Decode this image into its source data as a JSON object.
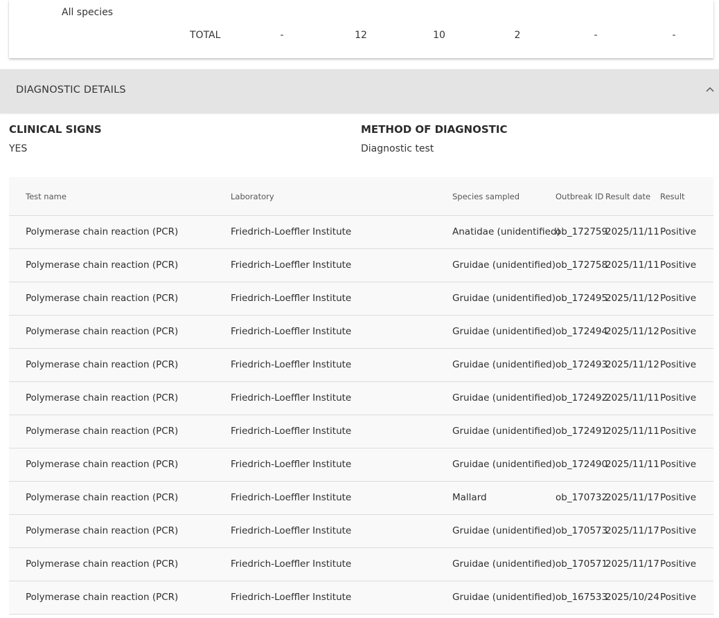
{
  "summary": {
    "species_label": "All species",
    "total_label": "TOTAL",
    "values": [
      "-",
      "12",
      "10",
      "2",
      "-",
      "-"
    ]
  },
  "diagnostic": {
    "section_title": "DIAGNOSTIC DETAILS",
    "clinical_signs_label": "CLINICAL SIGNS",
    "clinical_signs_value": "YES",
    "method_label": "METHOD OF DIAGNOSTIC",
    "method_value": "Diagnostic test"
  },
  "table": {
    "headers": [
      "Test name",
      "Laboratory",
      "Species sampled",
      "Outbreak ID",
      "Result date",
      "Result"
    ],
    "rows": [
      [
        "Polymerase chain reaction (PCR)",
        "Friedrich-Loeffler Institute",
        "Anatidae (unidentified)",
        "ob_172759",
        "2025/11/11",
        "Positive"
      ],
      [
        "Polymerase chain reaction (PCR)",
        "Friedrich-Loeffler Institute",
        "Gruidae (unidentified)",
        "ob_172758",
        "2025/11/11",
        "Positive"
      ],
      [
        "Polymerase chain reaction (PCR)",
        "Friedrich-Loeffler Institute",
        "Gruidae (unidentified)",
        "ob_172495",
        "2025/11/12",
        "Positive"
      ],
      [
        "Polymerase chain reaction (PCR)",
        "Friedrich-Loeffler Institute",
        "Gruidae (unidentified)",
        "ob_172494",
        "2025/11/12",
        "Positive"
      ],
      [
        "Polymerase chain reaction (PCR)",
        "Friedrich-Loeffler Institute",
        "Gruidae (unidentified)",
        "ob_172493",
        "2025/11/12",
        "Positive"
      ],
      [
        "Polymerase chain reaction (PCR)",
        "Friedrich-Loeffler Institute",
        "Gruidae (unidentified)",
        "ob_172492",
        "2025/11/11",
        "Positive"
      ],
      [
        "Polymerase chain reaction (PCR)",
        "Friedrich-Loeffler Institute",
        "Gruidae (unidentified)",
        "ob_172491",
        "2025/11/11",
        "Positive"
      ],
      [
        "Polymerase chain reaction (PCR)",
        "Friedrich-Loeffler Institute",
        "Gruidae (unidentified)",
        "ob_172490",
        "2025/11/11",
        "Positive"
      ],
      [
        "Polymerase chain reaction (PCR)",
        "Friedrich-Loeffler Institute",
        "Mallard",
        "ob_170732",
        "2025/11/17",
        "Positive"
      ],
      [
        "Polymerase chain reaction (PCR)",
        "Friedrich-Loeffler Institute",
        "Gruidae (unidentified)",
        "ob_170573",
        "2025/11/17",
        "Positive"
      ],
      [
        "Polymerase chain reaction (PCR)",
        "Friedrich-Loeffler Institute",
        "Gruidae (unidentified)",
        "ob_170571",
        "2025/11/17",
        "Positive"
      ],
      [
        "Polymerase chain reaction (PCR)",
        "Friedrich-Loeffler Institute",
        "Gruidae (unidentified)",
        "ob_167533",
        "2025/10/24",
        "Positive"
      ]
    ]
  },
  "icons": {
    "accordion_toggle": "chevron-up-icon"
  }
}
